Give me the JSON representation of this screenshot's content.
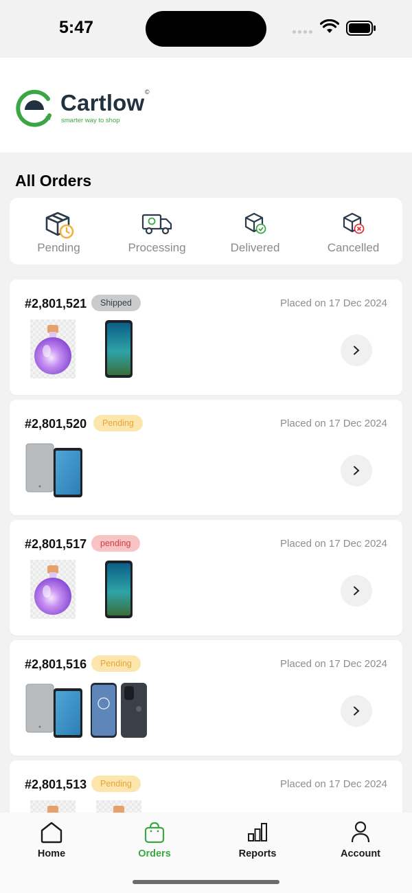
{
  "status_bar": {
    "time": "5:47"
  },
  "brand": {
    "name": "Cartlow",
    "tagline": "smarter way to shop",
    "copyright_mark": "©",
    "color": "#3aa744"
  },
  "page": {
    "title": "All Orders"
  },
  "filters": [
    {
      "label": "Pending",
      "icon": "box-clock-icon"
    },
    {
      "label": "Processing",
      "icon": "delivery-truck-icon"
    },
    {
      "label": "Delivered",
      "icon": "box-check-icon"
    },
    {
      "label": "Cancelled",
      "icon": "box-cancel-icon"
    }
  ],
  "orders": [
    {
      "number": "#2,801,521",
      "status": "Shipped",
      "date": "Placed on 17 Dec 2024",
      "products": [
        "perfume-bottle",
        "smartphone-lenovo"
      ]
    },
    {
      "number": "#2,801,520",
      "status": "Pending",
      "date": "Placed on 17 Dec 2024",
      "products": [
        "tablet-lenovo"
      ]
    },
    {
      "number": "#2,801,517",
      "status": "pending",
      "date": "Placed on 17 Dec 2024",
      "products": [
        "perfume-bottle",
        "smartphone-lenovo"
      ]
    },
    {
      "number": "#2,801,516",
      "status": "Pending",
      "date": "Placed on 17 Dec 2024",
      "products": [
        "tablet-lenovo",
        "smartphone-motorola"
      ]
    },
    {
      "number": "#2,801,513",
      "status": "Pending",
      "date": "Placed on 17 Dec 2024",
      "products": [
        "perfume-bottle",
        "perfume-bottle"
      ]
    }
  ],
  "nav": [
    {
      "label": "Home",
      "icon": "home-icon",
      "active": false
    },
    {
      "label": "Orders",
      "icon": "shopping-bag-icon",
      "active": true
    },
    {
      "label": "Reports",
      "icon": "bar-chart-icon",
      "active": false
    },
    {
      "label": "Account",
      "icon": "user-icon",
      "active": false
    }
  ],
  "colors": {
    "pending_badge": "#fde6ad",
    "pending_red_badge": "#f8c3c5",
    "shipped_badge": "#c9cbcd"
  }
}
